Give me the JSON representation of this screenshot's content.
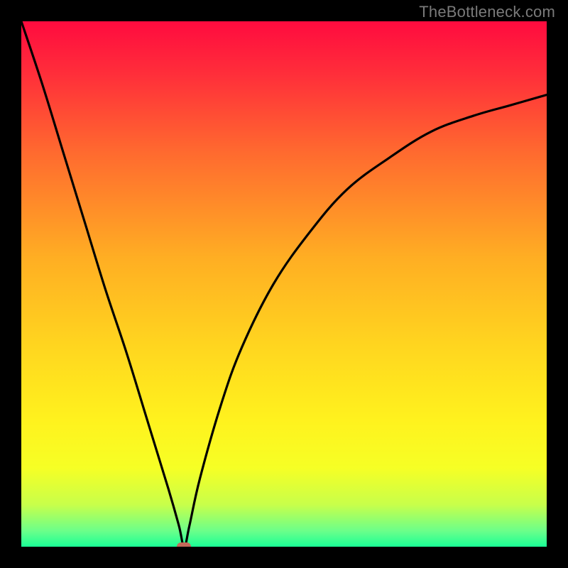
{
  "watermark": "TheBottleneck.com",
  "chart_data": {
    "type": "line",
    "title": "",
    "xlabel": "",
    "ylabel": "",
    "xlim": [
      0,
      100
    ],
    "ylim": [
      0,
      100
    ],
    "grid": false,
    "legend": false,
    "gradient_stops": [
      {
        "offset": 0,
        "color": "#ff0b3f"
      },
      {
        "offset": 0.1,
        "color": "#ff2e3a"
      },
      {
        "offset": 0.25,
        "color": "#ff6a2f"
      },
      {
        "offset": 0.45,
        "color": "#ffae23"
      },
      {
        "offset": 0.62,
        "color": "#ffd61f"
      },
      {
        "offset": 0.76,
        "color": "#fff21e"
      },
      {
        "offset": 0.85,
        "color": "#f6ff25"
      },
      {
        "offset": 0.92,
        "color": "#c8ff4a"
      },
      {
        "offset": 0.97,
        "color": "#6bff8a"
      },
      {
        "offset": 1.0,
        "color": "#1aff96"
      }
    ],
    "series": [
      {
        "name": "bottleneck-curve",
        "color": "#000000",
        "x": [
          0,
          4,
          8,
          12,
          16,
          20,
          24,
          28,
          30,
          31,
          32,
          34,
          38,
          42,
          48,
          55,
          62,
          70,
          78,
          86,
          93,
          100
        ],
        "y": [
          100,
          88,
          75,
          62,
          49,
          37,
          24,
          11,
          4,
          0,
          4,
          13,
          27,
          38,
          50,
          60,
          68,
          74,
          79,
          82,
          84,
          86
        ]
      }
    ],
    "marker": {
      "x": 31,
      "y": 0,
      "color": "#c46a5a",
      "name": "optimal-point"
    }
  }
}
